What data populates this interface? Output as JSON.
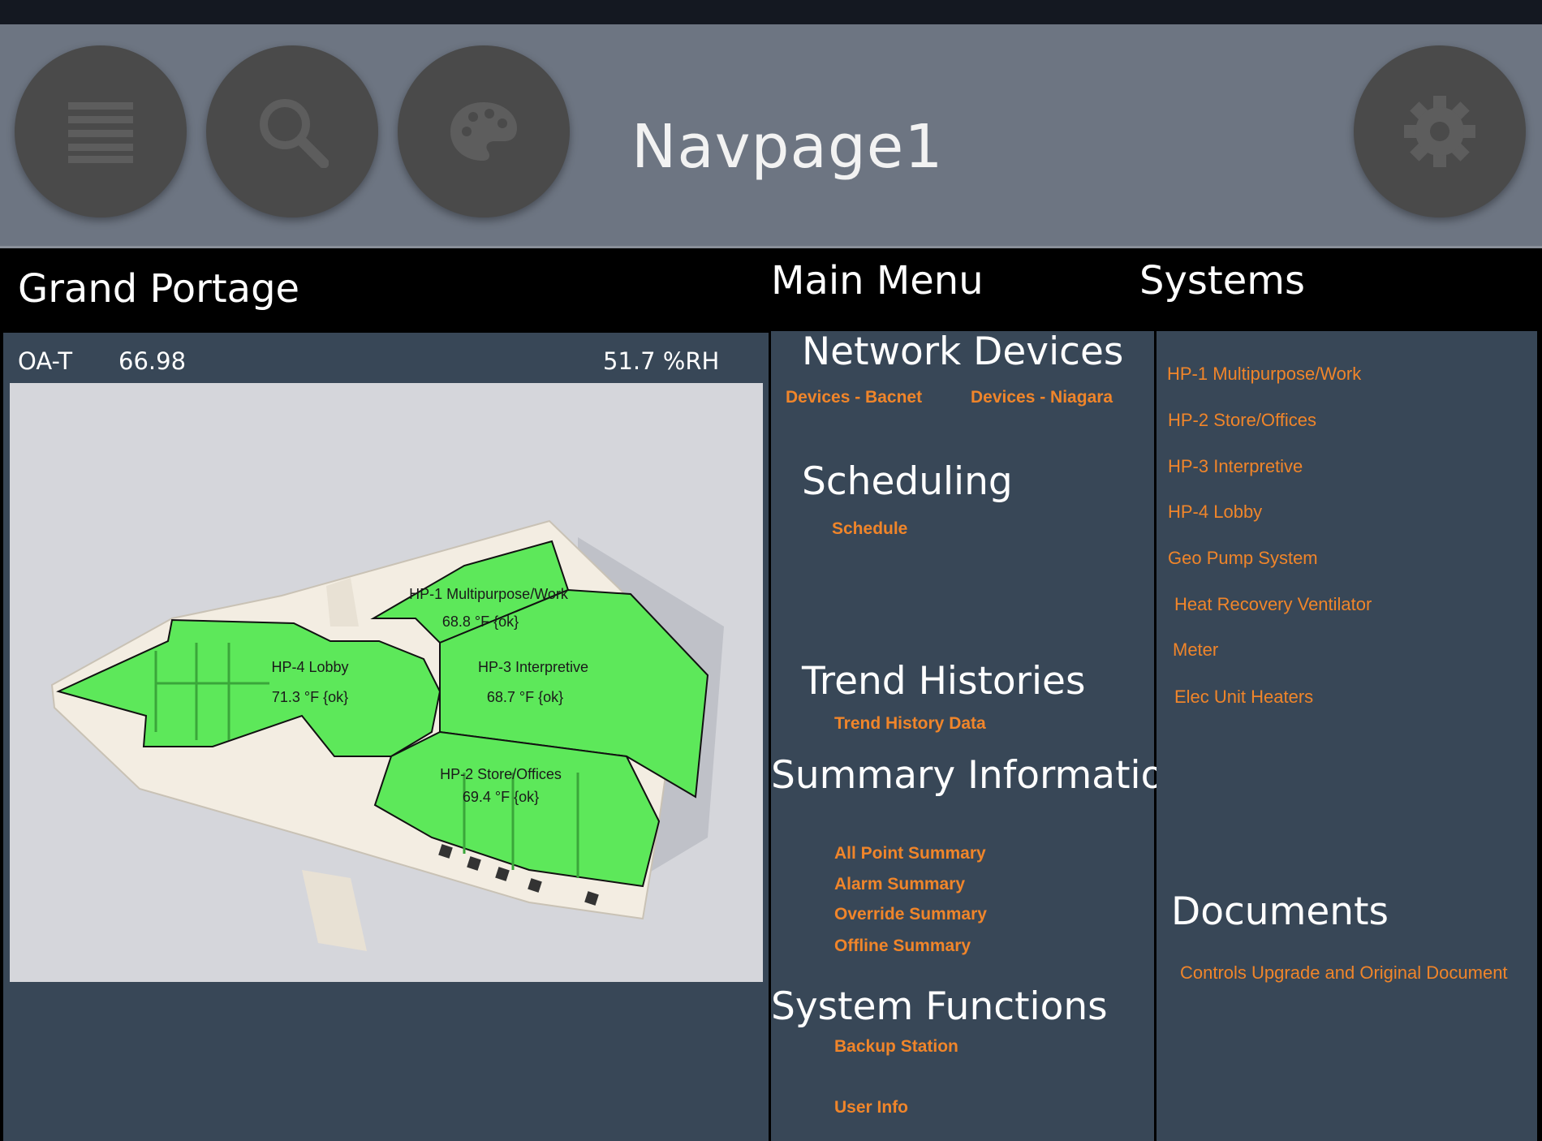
{
  "header": {
    "title": "Navpage1",
    "buttons": [
      {
        "name": "menu",
        "icon": "hamburger-menu-icon"
      },
      {
        "name": "search",
        "icon": "search-icon"
      },
      {
        "name": "theme",
        "icon": "palette-icon"
      },
      {
        "name": "settings",
        "icon": "gear-icon"
      }
    ]
  },
  "site": {
    "title": "Grand Portage",
    "oa_label": "OA-T",
    "oa_value": "66.98",
    "humidity": "51.7 %RH"
  },
  "zones": [
    {
      "name": "HP-1 Multipurpose/Work",
      "temp": "68.8 °F {ok}"
    },
    {
      "name": "HP-4 Lobby",
      "temp": "71.3 °F {ok}"
    },
    {
      "name": "HP-3 Interpretive",
      "temp": "68.7 °F {ok}"
    },
    {
      "name": "HP-2 Store/Offices",
      "temp": "69.4 °F {ok}"
    }
  ],
  "main_menu": {
    "title": "Main Menu",
    "network_devices": {
      "title": "Network Devices",
      "links": [
        "Devices - Bacnet",
        "Devices - Niagara"
      ]
    },
    "scheduling": {
      "title": "Scheduling",
      "links": [
        "Schedule"
      ]
    },
    "trend_histories": {
      "title": "Trend Histories",
      "links": [
        "Trend History Data"
      ]
    },
    "summary_information": {
      "title": "Summary Information",
      "links": [
        "All Point Summary",
        "Alarm Summary",
        "Override Summary",
        "Offline Summary"
      ]
    },
    "system_functions": {
      "title": "System Functions",
      "links": [
        "Backup Station",
        "User Info"
      ]
    }
  },
  "systems": {
    "title": "Systems",
    "links": [
      "HP-1 Multipurpose/Work",
      "HP-2 Store/Offices",
      "HP-3 Interpretive",
      "HP-4 Lobby",
      "Geo Pump System",
      "Heat Recovery Ventilator",
      "Meter",
      "Elec Unit Heaters"
    ]
  },
  "documents": {
    "title": "Documents",
    "links": [
      "Controls Upgrade and Original Document"
    ]
  },
  "colors": {
    "link_orange": "#f0852a",
    "panel": "#384757",
    "header": "#6d7582",
    "zone_green": "#5de85a"
  }
}
